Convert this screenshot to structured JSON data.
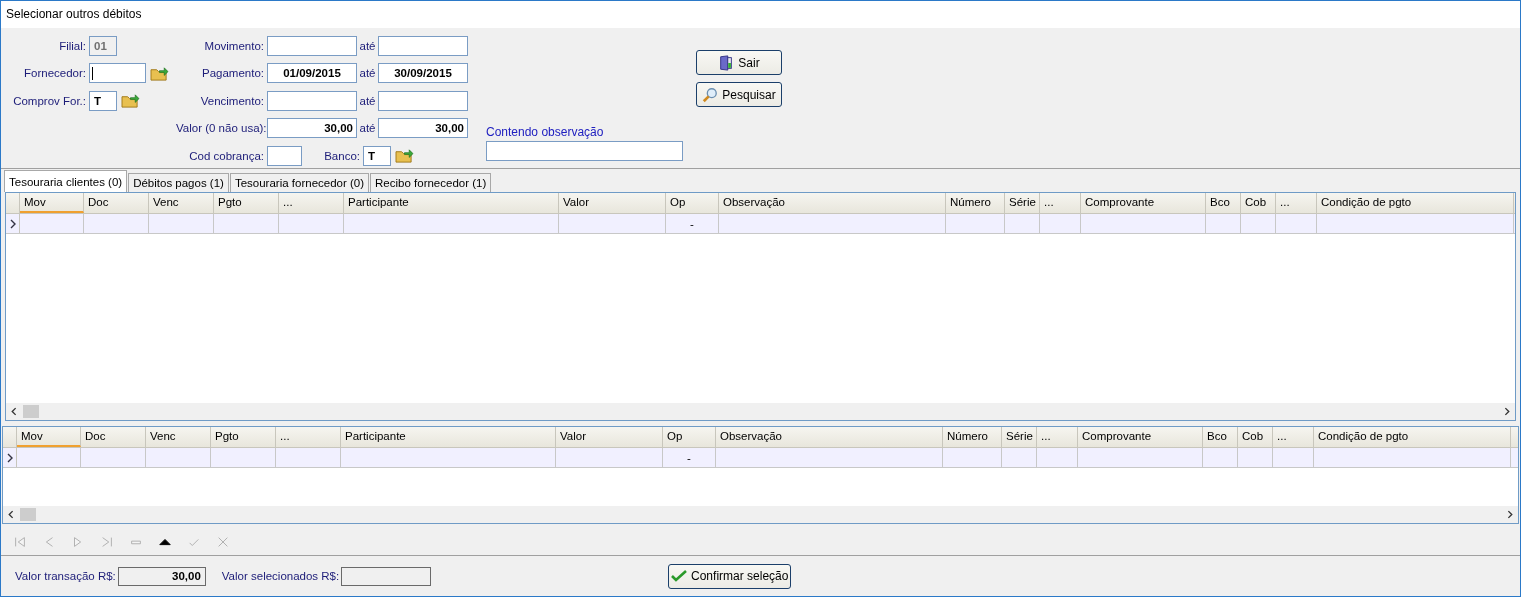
{
  "window": {
    "title": "Selecionar outros débitos"
  },
  "left_fields": [
    {
      "label": "Filial:",
      "value": "01",
      "disabled": true,
      "lookup": false,
      "focused": false
    },
    {
      "label": "Fornecedor:",
      "disabled": false,
      "lookup": true,
      "focused": true
    },
    {
      "label": "Comprov For.:",
      "value": "T",
      "disabled": false,
      "lookup": true,
      "focused": false
    }
  ],
  "ranges": [
    {
      "label": "Movimento:",
      "to_label": "até",
      "kind": "date"
    },
    {
      "label": "Pagamento:",
      "to_label": "até",
      "kind": "date",
      "from_value": "01/09/2015",
      "to_value": "30/09/2015"
    },
    {
      "label": "Vencimento:",
      "to_label": "até",
      "kind": "date"
    },
    {
      "label": "Valor (0 não usa):",
      "to_label": "até",
      "kind": "amount",
      "from_value": "30,00",
      "to_value": "30,00"
    }
  ],
  "cod_cobranca": {
    "label": "Cod cobrança:"
  },
  "banco": {
    "label": "Banco:",
    "value": "T"
  },
  "observation": {
    "label": "Contendo observação"
  },
  "buttons": [
    {
      "label": "Sair"
    },
    {
      "label": "Pesquisar"
    }
  ],
  "tabs": [
    {
      "label": "Tesouraria clientes (0)",
      "selected": true
    },
    {
      "label": "Débitos pagos (1)",
      "selected": false
    },
    {
      "label": "Tesouraria fornecedor (0)",
      "selected": false
    },
    {
      "label": "Recibo fornecedor (1)",
      "selected": false
    }
  ],
  "grids": [
    {
      "columns": [
        {
          "label": "Mov",
          "focused": true
        },
        {
          "label": "Doc",
          "focused": false
        },
        {
          "label": "Venc",
          "focused": false
        },
        {
          "label": "Pgto",
          "focused": false
        },
        {
          "label": "...",
          "focused": false
        },
        {
          "label": "Participante",
          "focused": false
        },
        {
          "label": "Valor",
          "focused": false
        },
        {
          "label": "Op",
          "focused": false,
          "kind": "op"
        },
        {
          "label": "Observação",
          "focused": false
        },
        {
          "label": "Número",
          "focused": false
        },
        {
          "label": "Série",
          "focused": false
        },
        {
          "label": "...",
          "focused": false
        },
        {
          "label": "Comprovante",
          "focused": false
        },
        {
          "label": "Bco",
          "focused": false
        },
        {
          "label": "Cob",
          "focused": false
        },
        {
          "label": "...",
          "focused": false
        },
        {
          "label": "Condição de pgto",
          "focused": false
        }
      ],
      "rows": [
        {
          "current": true,
          "op": "-"
        }
      ]
    },
    {
      "columns": [
        {
          "label": "Mov",
          "focused": true
        },
        {
          "label": "Doc",
          "focused": false
        },
        {
          "label": "Venc",
          "focused": false
        },
        {
          "label": "Pgto",
          "focused": false
        },
        {
          "label": "...",
          "focused": false
        },
        {
          "label": "Participante",
          "focused": false
        },
        {
          "label": "Valor",
          "focused": false
        },
        {
          "label": "Op",
          "focused": false,
          "kind": "op"
        },
        {
          "label": "Observação",
          "focused": false
        },
        {
          "label": "Número",
          "focused": false
        },
        {
          "label": "Série",
          "focused": false
        },
        {
          "label": "...",
          "focused": false
        },
        {
          "label": "Comprovante",
          "focused": false
        },
        {
          "label": "Bco",
          "focused": false
        },
        {
          "label": "Cob",
          "focused": false
        },
        {
          "label": "...",
          "focused": false
        },
        {
          "label": "Condição de pgto",
          "focused": false
        }
      ],
      "rows": [
        {
          "current": true,
          "op": "-"
        }
      ]
    }
  ],
  "navigator": [
    {
      "kind": "first",
      "disabled": true
    },
    {
      "kind": "prior",
      "disabled": true
    },
    {
      "kind": "next",
      "disabled": true
    },
    {
      "kind": "last",
      "disabled": true
    },
    {
      "kind": "delete",
      "disabled": true
    },
    {
      "kind": "edit",
      "disabled": false
    },
    {
      "kind": "post",
      "disabled": true
    },
    {
      "kind": "cancel",
      "disabled": true
    }
  ],
  "footer": {
    "transaction": {
      "label": "Valor transação R$:",
      "value": "30,00"
    },
    "selected": {
      "label": "Valor selecionados R$:"
    },
    "confirm": {
      "label": "Confirmar seleção"
    }
  }
}
